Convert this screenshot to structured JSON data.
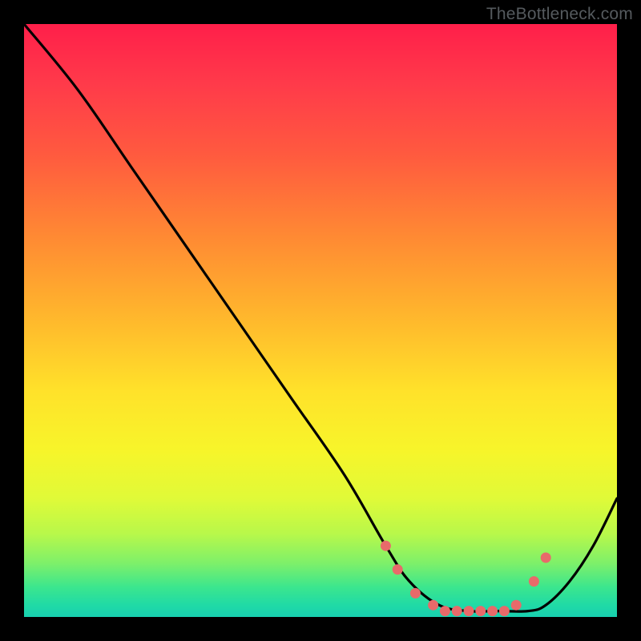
{
  "watermark": "TheBottleneck.com",
  "chart_data": {
    "type": "line",
    "title": "",
    "xlabel": "",
    "ylabel": "",
    "xlim": [
      0,
      100
    ],
    "ylim": [
      0,
      100
    ],
    "grid": false,
    "legend": false,
    "series": [
      {
        "name": "bottleneck-curve",
        "x": [
          0,
          9,
          18,
          27,
          36,
          45,
          54,
          61,
          65,
          70,
          75,
          80,
          85,
          88,
          92,
          96,
          100
        ],
        "y": [
          100,
          89,
          76,
          63,
          50,
          37,
          24,
          12,
          6,
          2,
          1,
          1,
          1,
          2,
          6,
          12,
          20
        ]
      }
    ],
    "markers": {
      "name": "highlight-points",
      "color": "#e86a6a",
      "x": [
        61,
        63,
        66,
        69,
        71,
        73,
        75,
        77,
        79,
        81,
        83,
        86,
        88
      ],
      "y": [
        12,
        8,
        4,
        2,
        1,
        1,
        1,
        1,
        1,
        1,
        2,
        6,
        10
      ]
    },
    "background_gradient": {
      "top": "#ff1f4a",
      "mid": "#ffe22a",
      "bottom": "#18d0b0"
    }
  }
}
